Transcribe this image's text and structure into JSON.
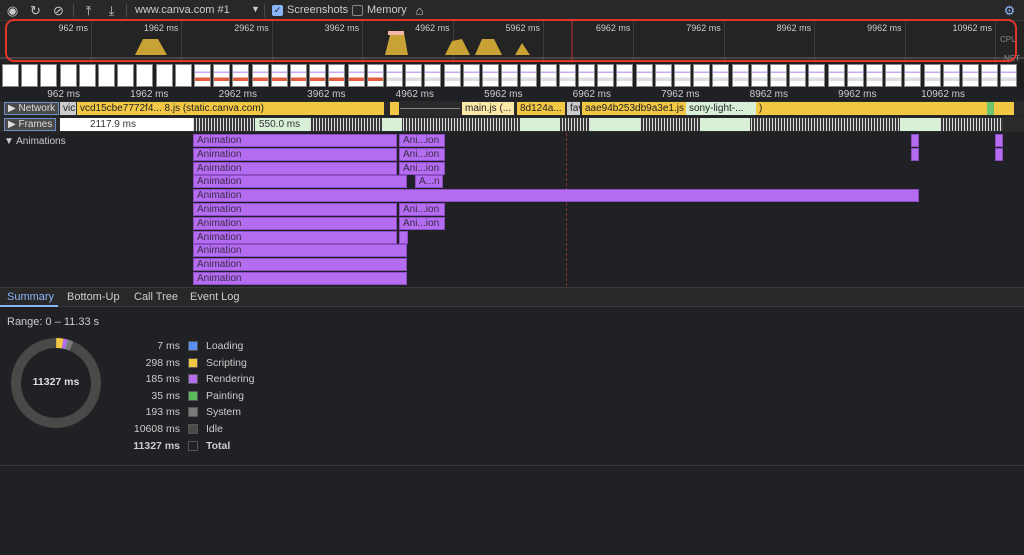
{
  "toolbar": {
    "target": "www.canva.com #1",
    "screenshots_label": "Screenshots",
    "screenshots_checked": true,
    "memory_label": "Memory",
    "memory_checked": false
  },
  "overview": {
    "ticks": [
      "962 ms",
      "1962 ms",
      "2962 ms",
      "3962 ms",
      "4962 ms",
      "5962 ms",
      "6962 ms",
      "7962 ms",
      "8962 ms",
      "9962 ms",
      "10962 ms"
    ],
    "cpu_label": "CPU",
    "net_label": "NET"
  },
  "ruler": {
    "ticks": [
      "962 ms",
      "1962 ms",
      "2962 ms",
      "3962 ms",
      "4962 ms",
      "5962 ms",
      "6962 ms",
      "7962 ms",
      "8962 ms",
      "9962 ms",
      "10962 ms"
    ]
  },
  "network": {
    "label": "Network",
    "requests": [
      "vic",
      "vcd15cbe7772f4... 8.js (static.canva.com)",
      "main.js (...",
      "8d124a...",
      "fav",
      "aae94b253db9a3e1.js (",
      "sony-light-...",
      ")"
    ]
  },
  "frames": {
    "label": "Frames",
    "values": [
      "2117.9 ms",
      "550.0 ms"
    ]
  },
  "animations": {
    "label": "Animations",
    "main_label": "Animation",
    "short_label": "Ani...ion",
    "tiny_label": "A...n"
  },
  "tabs": [
    "Summary",
    "Bottom-Up",
    "Call Tree",
    "Event Log"
  ],
  "summary": {
    "range": "Range: 0 – 11.33 s",
    "total_center": "11327 ms",
    "items": [
      {
        "value": "7 ms",
        "label": "Loading",
        "color": "#5a8ef0",
        "ms": 7
      },
      {
        "value": "298 ms",
        "label": "Scripting",
        "color": "#f2c744",
        "ms": 298
      },
      {
        "value": "185 ms",
        "label": "Rendering",
        "color": "#b46cf0",
        "ms": 185
      },
      {
        "value": "35 ms",
        "label": "Painting",
        "color": "#5cb85c",
        "ms": 35
      },
      {
        "value": "193 ms",
        "label": "System",
        "color": "#7a7a7a",
        "ms": 193
      },
      {
        "value": "10608 ms",
        "label": "Idle",
        "color": "#474a47",
        "ms": 10608
      },
      {
        "value": "11327 ms",
        "label": "Total",
        "color": "#202124",
        "ms": 0
      }
    ]
  }
}
